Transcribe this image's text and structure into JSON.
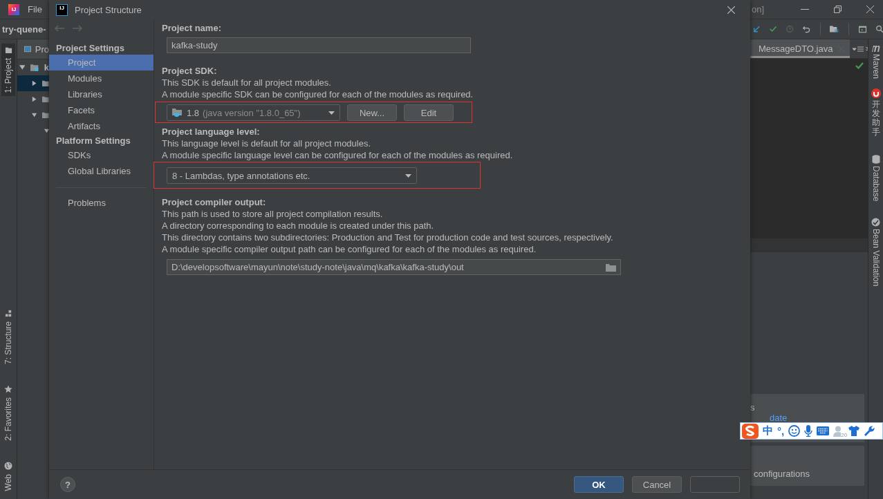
{
  "ide": {
    "logo_text": "IJ",
    "menu": [
      {
        "label": "File"
      }
    ],
    "window_title": "on]",
    "project_path": "try-quene-",
    "left_tool_windows": [
      {
        "label": "1: Project",
        "selected": true,
        "kind": "project"
      },
      {
        "label": "7: Structure",
        "selected": false,
        "kind": "structure"
      },
      {
        "label": "2: Favorites",
        "selected": false,
        "kind": "favorites"
      },
      {
        "label": "Web",
        "selected": false,
        "kind": "web"
      }
    ],
    "project_panel": {
      "title": "Pro",
      "tree": [
        {
          "label": "k",
          "expanded": true,
          "selected": false,
          "children": [
            {
              "expanded": false,
              "selected": true
            },
            {
              "expanded": false,
              "selected": false
            },
            {
              "expanded": true,
              "selected": false,
              "children": [
                {
                  "expanded": true,
                  "selected": false
                }
              ]
            }
          ]
        }
      ]
    },
    "editor_tabs": [
      {
        "label": "MessageDTO.java",
        "selected": true
      }
    ],
    "tab_count": "3",
    "right_tool_windows": [
      {
        "label": "Maven",
        "kind": "maven"
      },
      {
        "label": "开发助手",
        "kind": "helper"
      },
      {
        "label": "Database",
        "kind": "database"
      },
      {
        "label": "Bean Validation",
        "kind": "bean"
      }
    ],
    "bottom_cards": [
      {
        "texts": [
          "s",
          "date"
        ]
      },
      {
        "texts": [
          "configurations"
        ]
      }
    ]
  },
  "dialog": {
    "logo_text": "IJ",
    "title": "Project Structure",
    "sidebar": [
      {
        "heading": "Project Settings",
        "items": [
          {
            "label": "Project",
            "selected": true
          },
          {
            "label": "Modules",
            "selected": false
          },
          {
            "label": "Libraries",
            "selected": false
          },
          {
            "label": "Facets",
            "selected": false
          },
          {
            "label": "Artifacts",
            "selected": false
          }
        ]
      },
      {
        "heading": "Platform Settings",
        "items": [
          {
            "label": "SDKs",
            "selected": false
          },
          {
            "label": "Global Libraries",
            "selected": false
          }
        ]
      },
      {
        "items": [
          {
            "label": "Problems",
            "selected": false
          }
        ]
      }
    ],
    "project_name": {
      "label": "Project name:",
      "value": "kafka-study"
    },
    "project_sdk": {
      "label": "Project SDK:",
      "description": [
        "This SDK is default for all project modules.",
        "A module specific SDK can be configured for each of the modules as required."
      ],
      "version": "1.8",
      "detail": "(java version \"1.8.0_65\")",
      "buttons": [
        "New...",
        "Edit"
      ],
      "highlighted": true
    },
    "language_level": {
      "label": "Project language level:",
      "description": [
        "This language level is default for all project modules.",
        "A module specific language level can be configured for each of the modules as required."
      ],
      "value": "8 - Lambdas, type annotations etc.",
      "highlighted": true
    },
    "compiler_output": {
      "label": "Project compiler output:",
      "description": [
        "This path is used to store all project compilation results.",
        "A directory corresponding to each module is created under this path.",
        "This directory contains two subdirectories: Production and Test for production code and test sources, respectively.",
        "A module specific compiler output path can be configured for each of the modules as required."
      ],
      "value": "D:\\developsoftware\\mayun\\note\\study-note\\java\\mq\\kafka\\kafka-study\\out"
    },
    "help": "?",
    "buttons": [
      {
        "label": "OK",
        "default": true
      },
      {
        "label": "Cancel",
        "default": false
      }
    ]
  },
  "ime_toolbar": {
    "items": [
      {
        "kind": "text",
        "label": "中"
      },
      {
        "kind": "text",
        "label": "°,"
      },
      {
        "kind": "smiley"
      },
      {
        "kind": "mic"
      },
      {
        "kind": "keyboard"
      },
      {
        "kind": "skin",
        "badge": "20"
      },
      {
        "kind": "shirt"
      },
      {
        "kind": "wrench"
      }
    ]
  }
}
